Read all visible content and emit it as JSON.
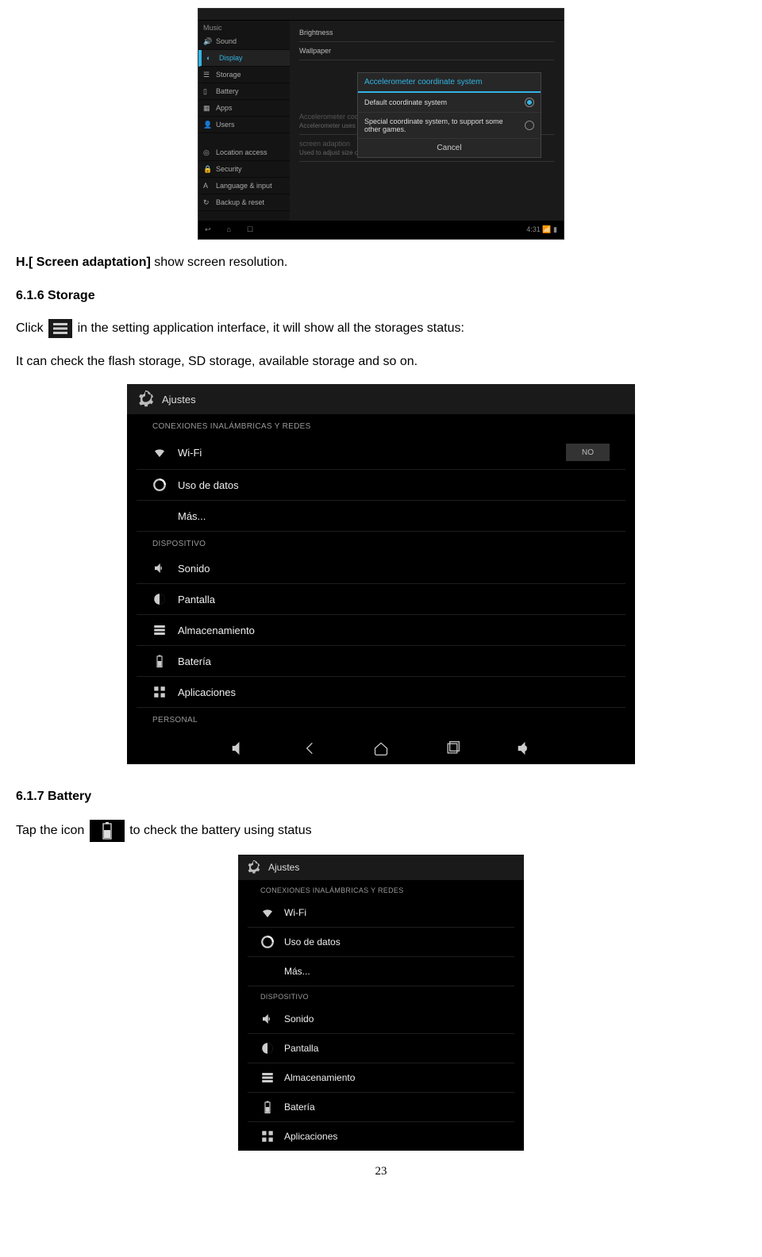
{
  "shot1": {
    "side_music": "Music",
    "item_sound": "Sound",
    "item_display": "Display",
    "item_storage": "Storage",
    "item_battery": "Battery",
    "item_apps": "Apps",
    "item_users": "Users",
    "item_location": "Location access",
    "item_security": "Security",
    "item_language": "Language & input",
    "item_backup": "Backup & reset",
    "right_brightness": "Brightness",
    "right_wallpaper": "Wallpaper",
    "right_accel_title": "Accelerometer coordinate system",
    "right_accel_sub": "Accelerometer uses the default coordinate system",
    "right_screen_adapt": "screen adaption",
    "right_screen_adapt_sub": "Used to adjust size of some games display screen",
    "dialog_title": "Accelerometer coordinate system",
    "dialog_opt1": "Default coordinate system",
    "dialog_opt2": "Special coordinate system, to support some other games.",
    "dialog_cancel": "Cancel",
    "clock": "4:31"
  },
  "text": {
    "h_screen": "H.[ Screen adaptation]",
    "h_screen_rest": " show screen resolution.",
    "storage_heading": "6.1.6 Storage",
    "storage_line1_a": "Click ",
    "storage_line1_b": " in the setting application interface, it will show all the storages status:",
    "storage_line2": "It can check the flash storage, SD storage, available storage and so on.",
    "battery_heading": "6.1.7 Battery",
    "battery_line_a": "Tap the icon ",
    "battery_line_b": " to check the battery using status",
    "page_num": "23"
  },
  "shot2": {
    "title": "Ajustes",
    "section1": "CONEXIONES INALÁMBRICAS Y REDES",
    "wifi": "Wi-Fi",
    "wifi_toggle": "NO",
    "data": "Uso de datos",
    "more": "Más...",
    "section2": "DISPOSITIVO",
    "sound": "Sonido",
    "display": "Pantalla",
    "storage": "Almacenamiento",
    "battery": "Batería",
    "apps": "Aplicaciones",
    "section3": "PERSONAL"
  },
  "shot3": {
    "title": "Ajustes",
    "section1": "CONEXIONES INALÁMBRICAS Y REDES",
    "wifi": "Wi-Fi",
    "data": "Uso de datos",
    "more": "Más...",
    "section2": "DISPOSITIVO",
    "sound": "Sonido",
    "display": "Pantalla",
    "storage": "Almacenamiento",
    "battery": "Batería",
    "apps": "Aplicaciones"
  }
}
